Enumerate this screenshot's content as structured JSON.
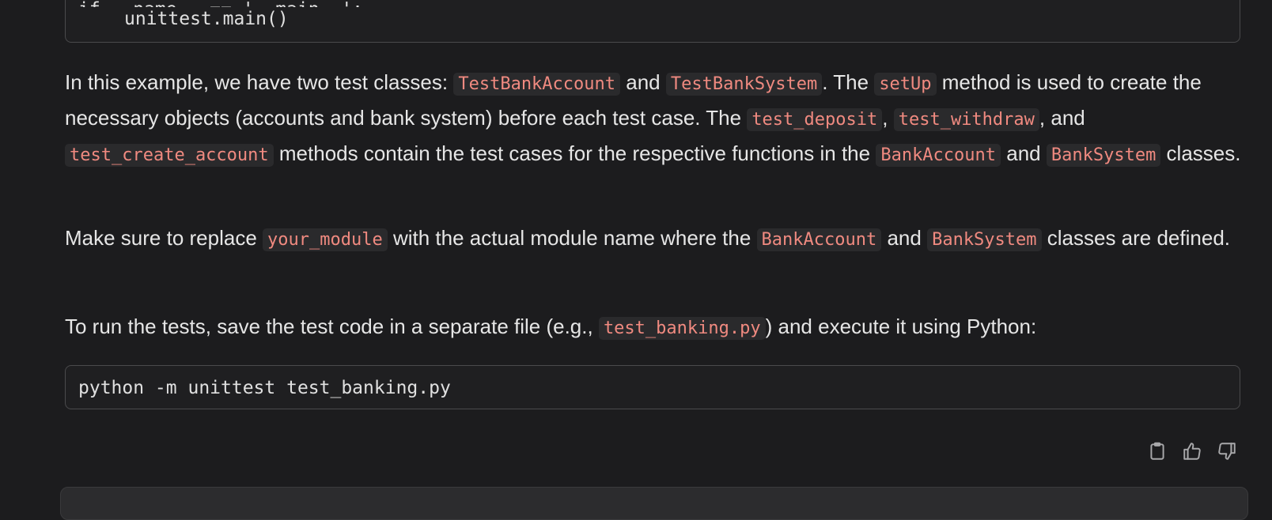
{
  "code_top": {
    "line1": "if __name__ == '__main__':",
    "line2": "unittest.main()"
  },
  "para1": {
    "t1": "In this example, we have two test classes: ",
    "c1": "TestBankAccount",
    "t2": " and ",
    "c2": "TestBankSystem",
    "t3": ". The ",
    "c3": "setUp",
    "t4": " method is used to create the necessary objects (accounts and bank system) before each test case. The ",
    "c4": "test_deposit",
    "t5": ", ",
    "c5": "test_withdraw",
    "t6": ", and ",
    "c6": "test_create_account",
    "t7": " methods contain the test cases for the respective functions in the ",
    "c7": "BankAccount",
    "t8": " and ",
    "c8": "BankSystem",
    "t9": " classes."
  },
  "para2": {
    "t1": "Make sure to replace ",
    "c1": "your_module",
    "t2": " with the actual module name where the ",
    "c2": "BankAccount",
    "t3": " and ",
    "c3": "BankSystem",
    "t4": " classes are defined."
  },
  "para3": {
    "t1": "To run the tests, save the test code in a separate file (e.g., ",
    "c1": "test_banking.py",
    "t2": ") and execute it using Python:"
  },
  "code_bottom": {
    "line1": "python -m unittest test_banking.py"
  },
  "actions": {
    "copy_icon": "clipboard-icon",
    "like_icon": "thumbs-up-icon",
    "dislike_icon": "thumbs-down-icon"
  },
  "colors": {
    "background": "#1c1c1e",
    "inline_code": "#f08a80",
    "text": "#e6e6e6"
  }
}
